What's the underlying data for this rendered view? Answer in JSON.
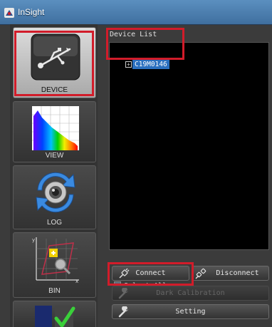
{
  "window": {
    "title": "InSight"
  },
  "sidebar": {
    "items": [
      {
        "label": "DEVICE",
        "icon": "usb-icon"
      },
      {
        "label": "VIEW",
        "icon": "spectrum-icon"
      },
      {
        "label": "LOG",
        "icon": "refresh-icon"
      },
      {
        "label": "BIN",
        "icon": "bin-chart-icon"
      },
      {
        "label": "",
        "icon": "checkmark-icon"
      }
    ]
  },
  "device_list": {
    "label": "Device List",
    "items": [
      {
        "id": "C19M0146",
        "selected": true
      }
    ]
  },
  "controls": {
    "select_all": "Select All",
    "connect": "Connect",
    "disconnect": "Disconnect",
    "dark_calibration": "Dark Calibration",
    "setting": "Setting"
  },
  "colors": {
    "highlight": "#d21c2a",
    "selection": "#2a6fbf",
    "list_bg": "#000000"
  }
}
